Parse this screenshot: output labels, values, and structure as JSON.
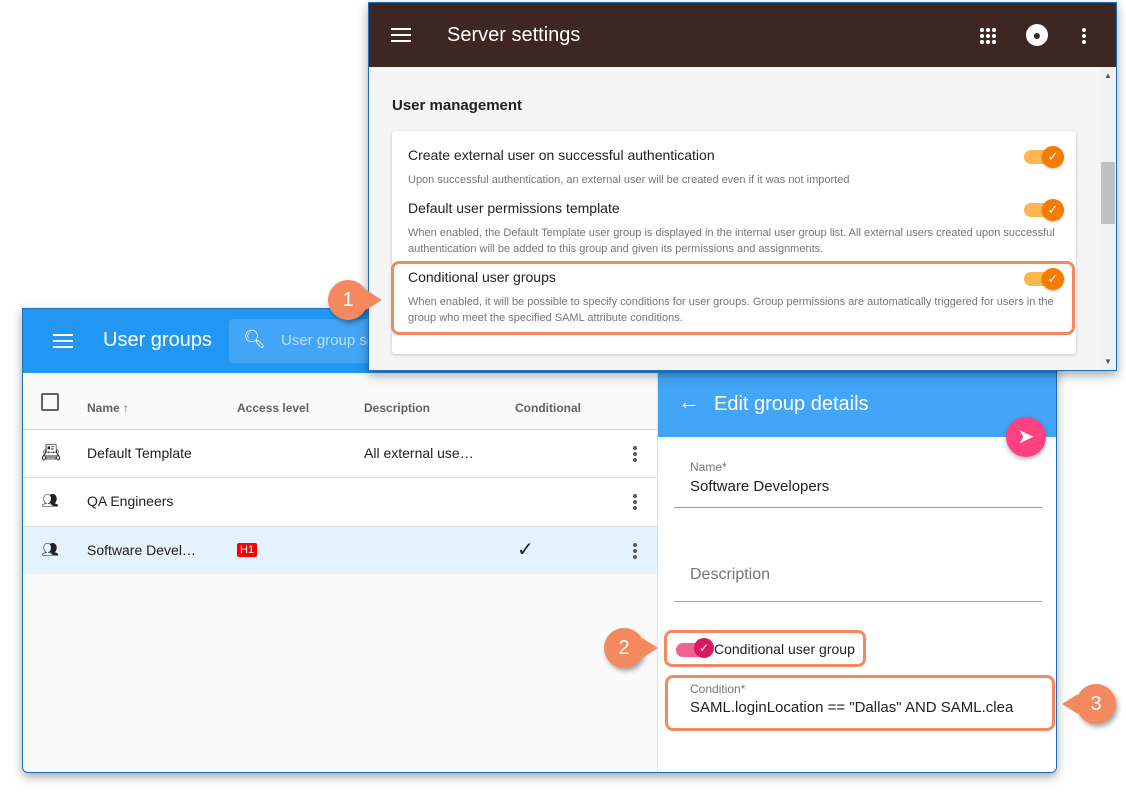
{
  "user_groups": {
    "title": "User groups",
    "search_placeholder": "User group se",
    "columns": {
      "name": "Name",
      "access": "Access level",
      "description": "Description",
      "conditional": "Conditional"
    },
    "rows": [
      {
        "icon": "contact-book-icon",
        "name": "Default Template",
        "access": "",
        "description": "All external use…",
        "conditional": ""
      },
      {
        "icon": "people-icon",
        "name": "QA Engineers",
        "access": "",
        "description": "",
        "conditional": ""
      },
      {
        "icon": "people-icon",
        "name": "Software Devel…",
        "access": "H1",
        "description": "",
        "conditional": "✓",
        "selected": true
      }
    ]
  },
  "edit_group": {
    "title": "Edit group details",
    "name_label": "Name*",
    "name_value": "Software Developers",
    "description_placeholder": "Description",
    "conditional_label": "Conditional user group",
    "conditional_on": true,
    "condition_label": "Condition*",
    "condition_value": "SAML.loginLocation == \"Dallas\" AND SAML.clea"
  },
  "server_settings": {
    "title": "Server settings",
    "section": "User management",
    "settings": [
      {
        "title": "Create external user on successful authentication",
        "desc": "Upon successful authentication, an external user will be created even if it was not imported",
        "enabled": true
      },
      {
        "title": "Default user permissions template",
        "desc": "When enabled, the Default Template user group is displayed in the internal user group list. All external users created upon successful authentication will be added to this group and given its permissions and assignments.",
        "enabled": true
      },
      {
        "title": "Conditional user groups",
        "desc": "When enabled, it will be possible to specify conditions for user groups. Group permissions are automatically triggered for users in the group who meet the specified SAML attribute conditions.",
        "enabled": true
      }
    ]
  },
  "callouts": [
    "1",
    "2",
    "3"
  ],
  "colors": {
    "user_groups_header": "#2196F3",
    "edit_header": "#42A5F5",
    "server_header": "#3E2723",
    "toggle": "#F57C00",
    "accent_pink": "#FF4081",
    "callout": "#F4895F",
    "badge": "#FF0000"
  }
}
